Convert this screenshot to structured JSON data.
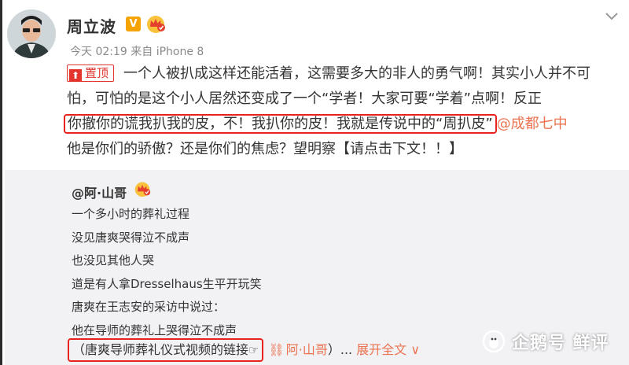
{
  "post": {
    "author_name": "周立波",
    "v_badge": "V",
    "timestamp": "今天 02:19 来自 iPhone 8",
    "pin_label": "置顶",
    "text_part1": "一个人被扒成这样还能活着，这需要多大的非人的勇气啊！其实小人并不可怕，可怕的是这个小人居然还变成了一个“学者！大家可要“学着”点啊！反正",
    "text_highlight": "你撤你的谎我扒我的皮，不！我扒你的皮！我就是传说中的“周扒皮”",
    "mention": "@成都七中",
    "text_part2": "他是你们的骄傲？还是你们的焦虑？望明察【请点击下文！！】"
  },
  "quote": {
    "user": "@阿·山哥",
    "lines": [
      "一个多小时的葬礼过程",
      "没见唐爽哭得泣不成声",
      "也没见其他人哭",
      "道是有人拿Dresselhaus生平开玩笑",
      "唐爽在王志安的采访中说过：",
      "他在导师的葬礼上哭得泣不成声"
    ],
    "last_line_highlight": "（唐爽导师葬礼仪式视频的链接",
    "last_link": "阿·山哥",
    "last_suffix": "）...",
    "expand_label": "展开全文 ∨"
  },
  "watermark": {
    "text": "企鹅号 鲜评"
  },
  "colors": {
    "accent_orange": "#eb7350",
    "highlight_red": "#e8231d",
    "pin_red": "#e3352e",
    "vip_gold": "#f5a300"
  },
  "icons": [
    "avatar",
    "v-badge-icon",
    "crown-icon",
    "chevron-down-icon",
    "pin-icon",
    "hand-pointer-icon",
    "link-icon",
    "penguin-logo-icon"
  ]
}
